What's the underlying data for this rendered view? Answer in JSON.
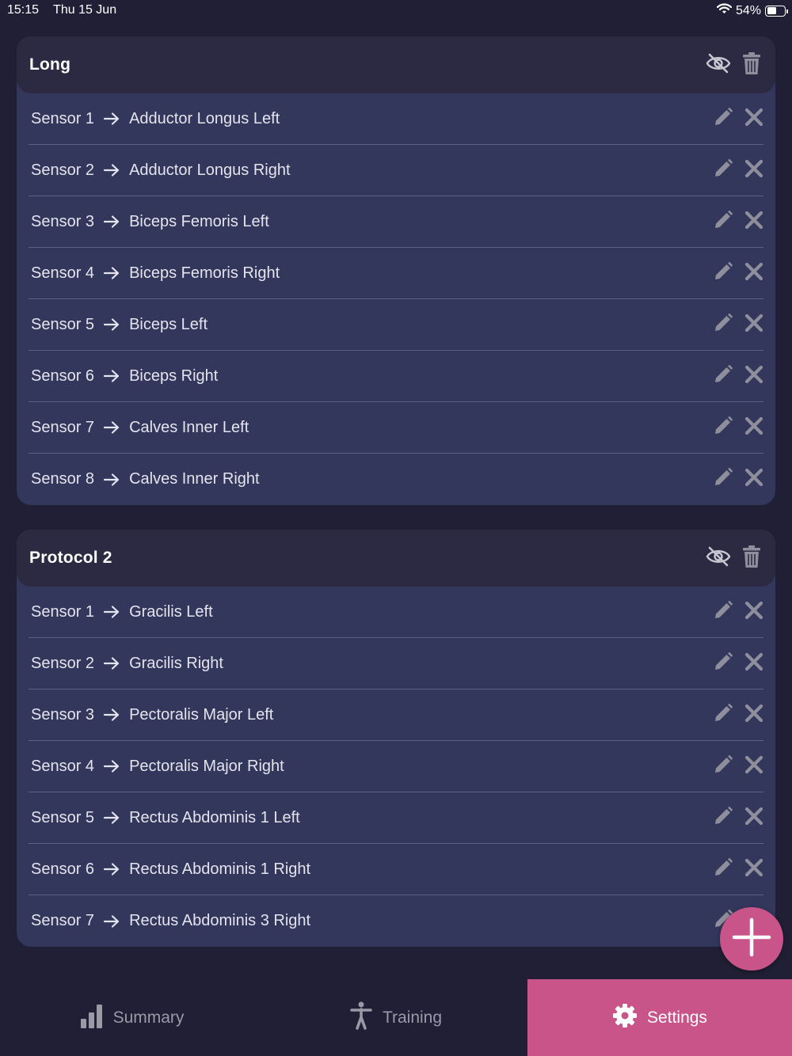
{
  "status_bar": {
    "time": "15:15",
    "date": "Thu 15 Jun",
    "battery": "54%",
    "battery_level": 0.54
  },
  "protocols": [
    {
      "title": "Long",
      "sensors": [
        {
          "sensor": "Sensor 1",
          "muscle": "Adductor Longus Left"
        },
        {
          "sensor": "Sensor 2",
          "muscle": "Adductor Longus Right"
        },
        {
          "sensor": "Sensor 3",
          "muscle": "Biceps Femoris Left"
        },
        {
          "sensor": "Sensor 4",
          "muscle": "Biceps Femoris Right"
        },
        {
          "sensor": "Sensor 5",
          "muscle": "Biceps Left"
        },
        {
          "sensor": "Sensor 6",
          "muscle": "Biceps Right"
        },
        {
          "sensor": "Sensor 7",
          "muscle": "Calves Inner Left"
        },
        {
          "sensor": "Sensor 8",
          "muscle": "Calves Inner Right"
        }
      ]
    },
    {
      "title": "Protocol 2",
      "sensors": [
        {
          "sensor": "Sensor 1",
          "muscle": "Gracilis Left"
        },
        {
          "sensor": "Sensor 2",
          "muscle": "Gracilis Right"
        },
        {
          "sensor": "Sensor 3",
          "muscle": "Pectoralis Major Left"
        },
        {
          "sensor": "Sensor 4",
          "muscle": "Pectoralis Major Right"
        },
        {
          "sensor": "Sensor 5",
          "muscle": "Rectus Abdominis 1 Left"
        },
        {
          "sensor": "Sensor 6",
          "muscle": "Rectus Abdominis 1 Right"
        },
        {
          "sensor": "Sensor 7",
          "muscle": "Rectus Abdominis 3 Right"
        }
      ]
    }
  ],
  "icons": {
    "header_actions": [
      "eye-off-icon",
      "trash-icon"
    ],
    "row_actions": [
      "pencil-icon",
      "close-icon"
    ],
    "arrow": "arrow-right-icon",
    "fab": "plus-icon"
  },
  "nav": [
    {
      "label": "Summary",
      "icon": "bar-chart-icon",
      "active": false
    },
    {
      "label": "Training",
      "icon": "person-icon",
      "active": false
    },
    {
      "label": "Settings",
      "icon": "gear-icon",
      "active": true
    }
  ],
  "colors": {
    "background": "#211f35",
    "card": "#32375b",
    "card_header": "#2c2942",
    "accent": "#c9548a",
    "icon_gray": "#9a99a6"
  }
}
